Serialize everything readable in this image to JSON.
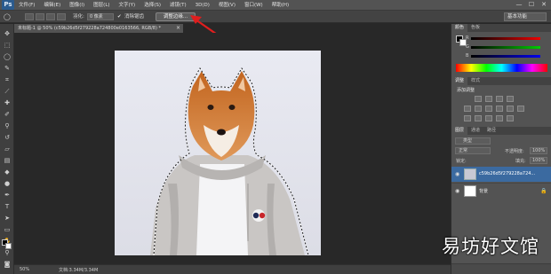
{
  "app": {
    "logo": "Ps"
  },
  "menu": [
    "文件(F)",
    "编辑(E)",
    "图像(I)",
    "图层(L)",
    "文字(Y)",
    "选择(S)",
    "滤镜(T)",
    "3D(D)",
    "视图(V)",
    "窗口(W)",
    "帮助(H)"
  ],
  "window_controls": {
    "minimize": "—",
    "maximize": "☐",
    "close": "✕"
  },
  "options": {
    "feather_label": "羽化:",
    "feather_value": "0 像素",
    "antialias_label": "消除锯齿",
    "refine_edge_button": "调整边缘...",
    "workspace": "基本功能"
  },
  "document": {
    "tab_title": "未标题-1 @ 50% (c59b26d5f279228a724800e0163566, RGB/8) *",
    "zoom": "50%",
    "doc_info": "文档:3.34M/3.34M"
  },
  "panels": {
    "color_tabs": [
      "颜色",
      "色板"
    ],
    "color_channels": [
      "R",
      "G",
      "B"
    ],
    "adjust_tabs": [
      "调整",
      "样式"
    ],
    "adjust_add_label": "添加调整",
    "layer_tabs": [
      "图层",
      "通道",
      "路径"
    ],
    "layer_filter": "类型",
    "blend_mode": "正常",
    "opacity_label": "不透明度:",
    "opacity_value": "100%",
    "lock_label": "锁定:",
    "fill_label": "填充:",
    "fill_value": "100%",
    "layers": [
      {
        "name": "c59b26d5f279228a724...",
        "active": true
      },
      {
        "name": "背景",
        "active": false
      }
    ]
  },
  "watermark": "易坊好文馆",
  "colors": {
    "accent": "#3b6aa0",
    "selection": "#ffffff",
    "annotation_arrow": "#e01e1e"
  },
  "icons": [
    "ps-logo-icon",
    "lasso-icon",
    "move-icon",
    "marquee-icon",
    "crop-icon",
    "eyedropper-icon",
    "brush-icon",
    "stamp-icon",
    "eraser-icon",
    "gradient-icon",
    "pen-icon",
    "text-icon",
    "hand-icon",
    "zoom-icon",
    "eye-icon",
    "lock-icon"
  ]
}
